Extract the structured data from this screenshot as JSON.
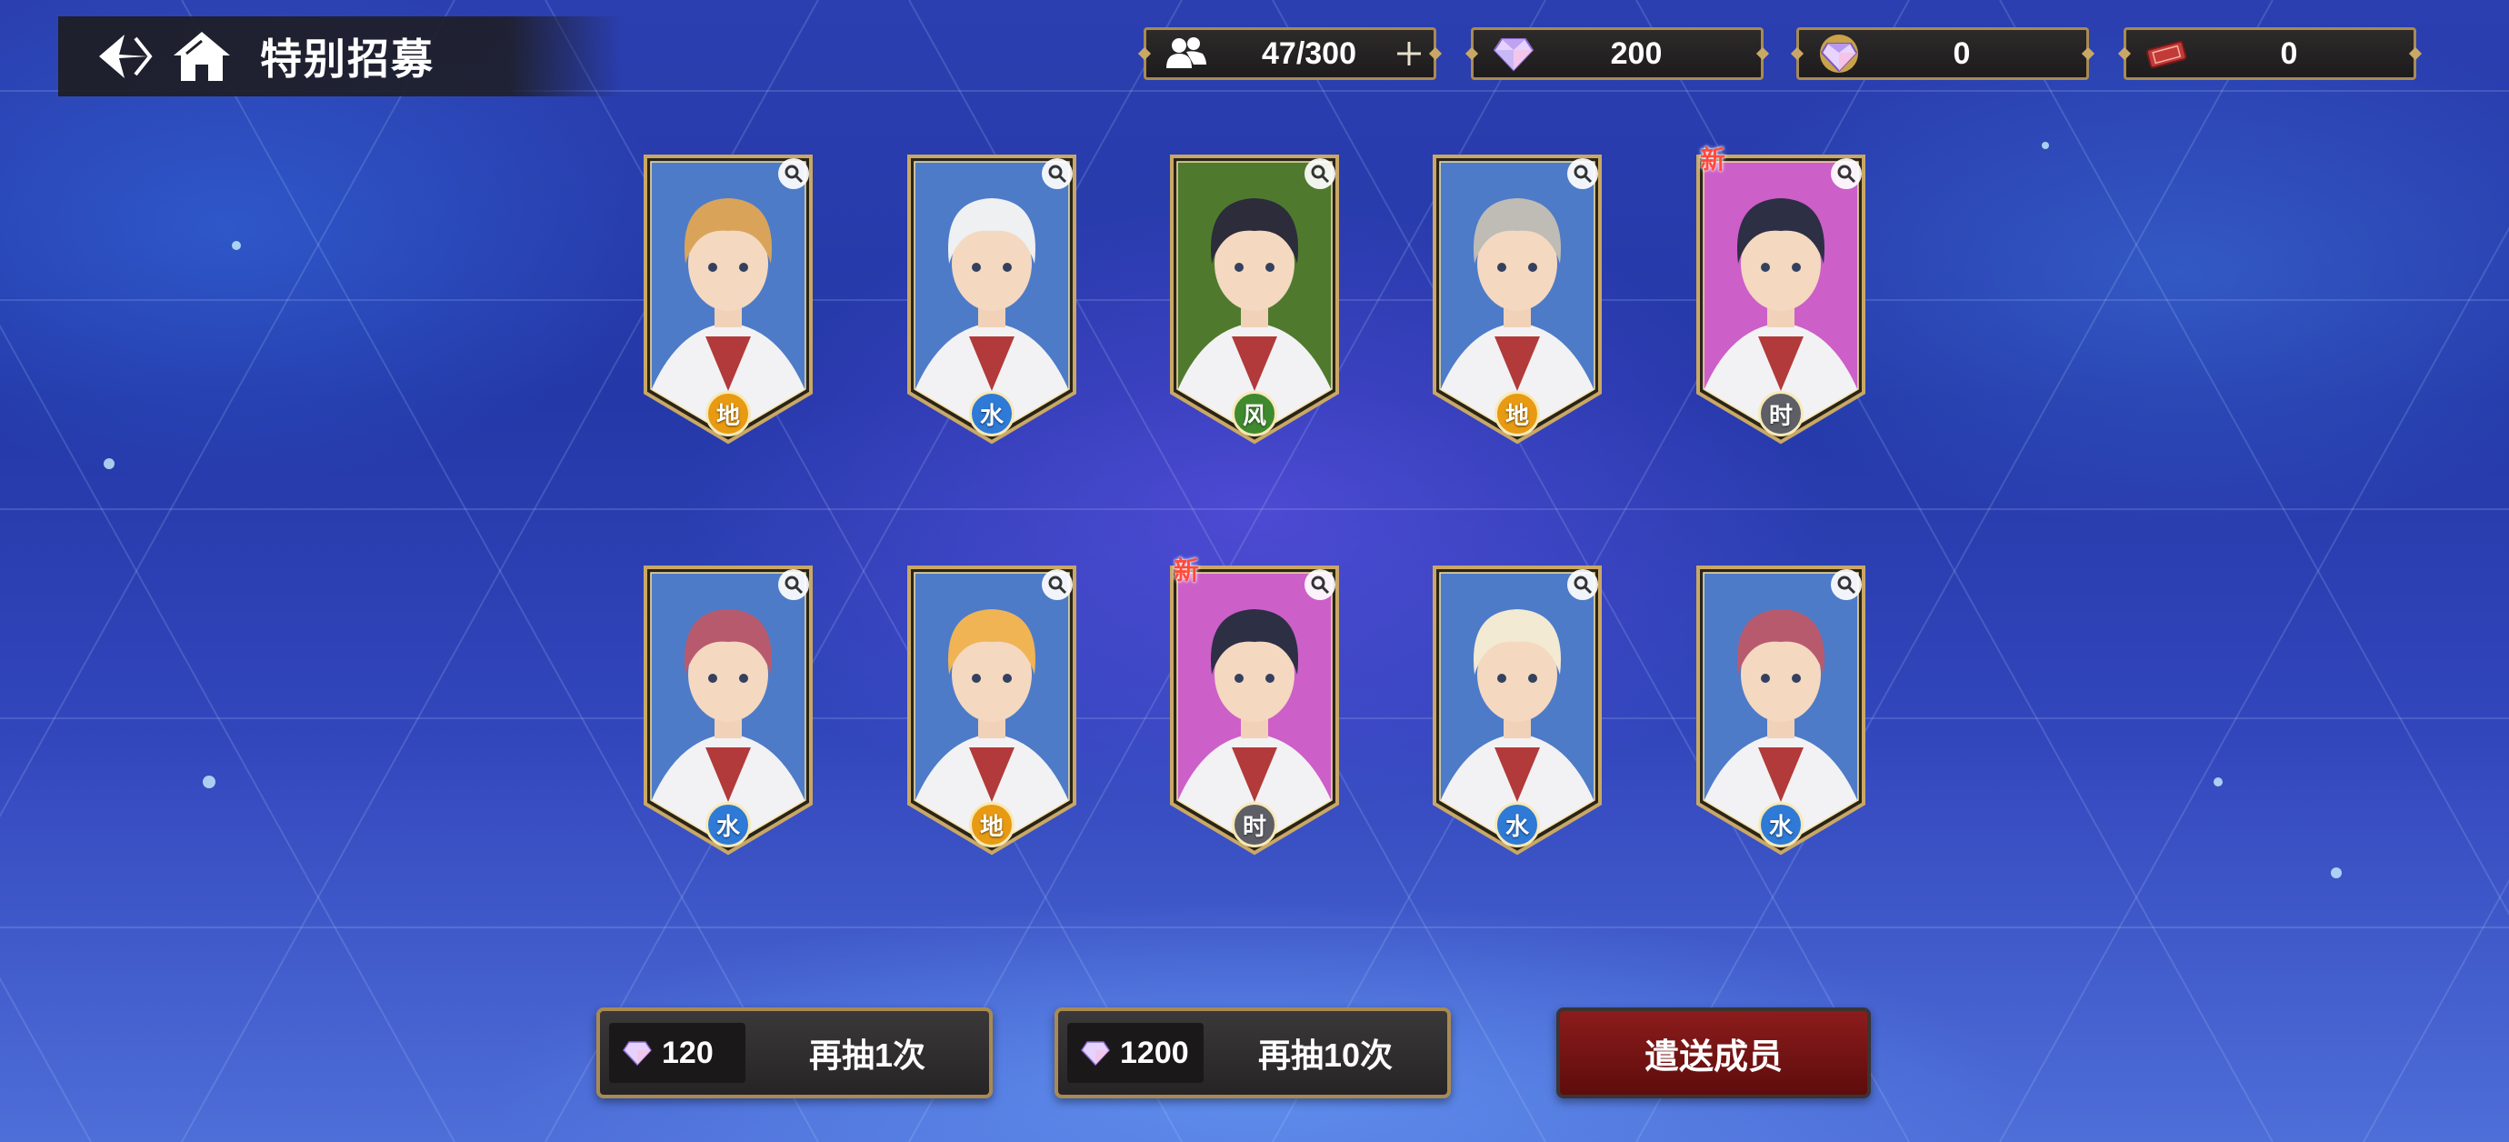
{
  "header": {
    "title": "特别招募",
    "back_icon": "back-arrow-icon",
    "home_icon": "home-icon"
  },
  "resources": [
    {
      "name": "members",
      "icon": "people-icon",
      "value": "47/300",
      "has_plus": true
    },
    {
      "name": "gems",
      "icon": "gem-icon",
      "value": "200",
      "has_plus": false
    },
    {
      "name": "premium-gems",
      "icon": "premium-gem-icon",
      "value": "0",
      "has_plus": false
    },
    {
      "name": "tickets",
      "icon": "ticket-icon",
      "value": "0",
      "has_plus": false
    }
  ],
  "results": {
    "row1": [
      {
        "element": "地",
        "element_color": "#e89a12",
        "bg": "#4d7bc8",
        "hair": "#d9a45a",
        "is_new": false
      },
      {
        "element": "水",
        "element_color": "#2e7ad6",
        "bg": "#4d7bc8",
        "hair": "#eef0f2",
        "is_new": false
      },
      {
        "element": "风",
        "element_color": "#3f8a2e",
        "bg": "#4f7a2e",
        "hair": "#2c2c3a",
        "is_new": false
      },
      {
        "element": "地",
        "element_color": "#e89a12",
        "bg": "#4d7bc8",
        "hair": "#bfbcb6",
        "is_new": false
      },
      {
        "element": "时",
        "element_color": "#5e5e66",
        "bg": "#cc5fc8",
        "hair": "#2d2f45",
        "is_new": true,
        "new_label": "新"
      }
    ],
    "row2": [
      {
        "element": "水",
        "element_color": "#2e7ad6",
        "bg": "#4d7bc8",
        "hair": "#b85a6e",
        "is_new": false
      },
      {
        "element": "地",
        "element_color": "#e89a12",
        "bg": "#4d7bc8",
        "hair": "#f0b454",
        "is_new": false
      },
      {
        "element": "时",
        "element_color": "#5e5e66",
        "bg": "#cc5fc8",
        "hair": "#2d2f45",
        "is_new": true,
        "new_label": "新"
      },
      {
        "element": "水",
        "element_color": "#2e7ad6",
        "bg": "#4d7bc8",
        "hair": "#f2ead2",
        "is_new": false
      },
      {
        "element": "水",
        "element_color": "#2e7ad6",
        "bg": "#4d7bc8",
        "hair": "#b85a6e",
        "is_new": false
      }
    ]
  },
  "actions": {
    "draw_once": {
      "cost": "120",
      "label": "再抽1次"
    },
    "draw_ten": {
      "cost": "1200",
      "label": "再抽10次"
    },
    "dispatch": {
      "label": "遣送成员"
    }
  },
  "colors": {
    "frame_gold": "#c9a866",
    "button_border": "#a98a52",
    "dispatch_red": "#8c1c1c"
  }
}
